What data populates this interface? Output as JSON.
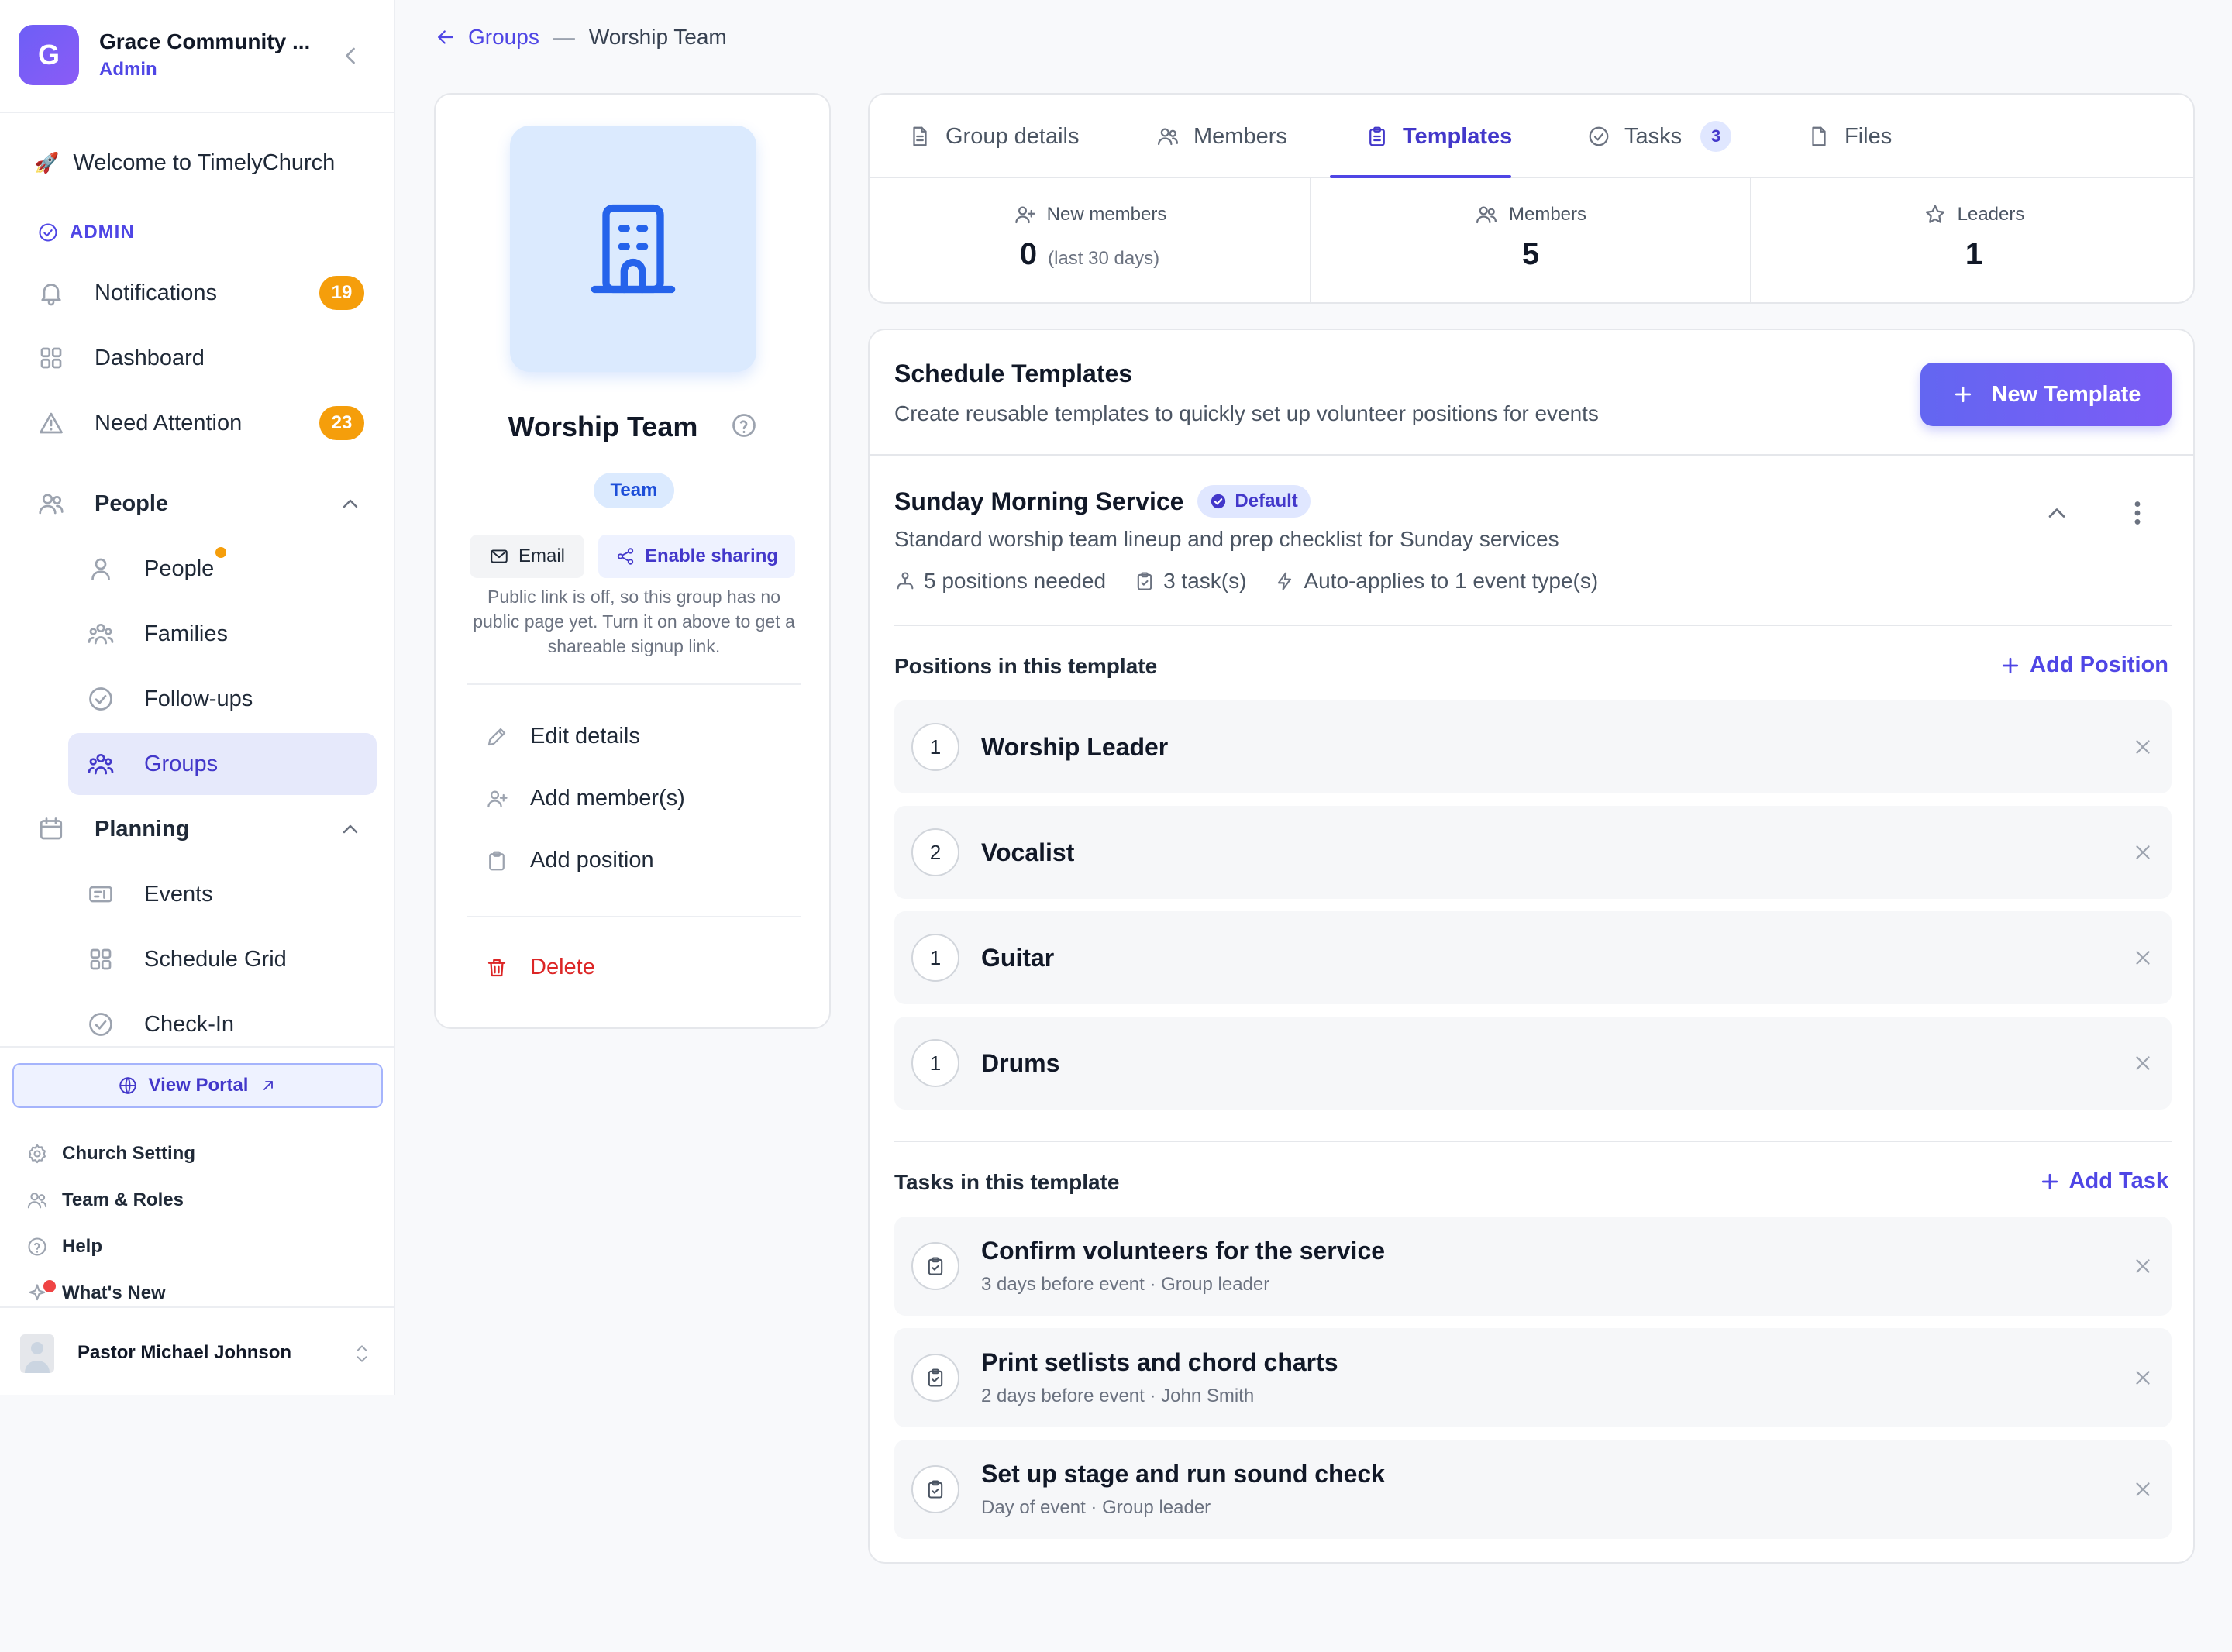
{
  "sidebar": {
    "org_initial": "G",
    "org_name": "Grace Community ...",
    "org_role": "Admin",
    "welcome": "Welcome to TimelyChurch",
    "admin_label": "ADMIN",
    "notifications": {
      "label": "Notifications",
      "count": "19"
    },
    "dashboard": {
      "label": "Dashboard"
    },
    "need_attention": {
      "label": "Need Attention",
      "count": "23"
    },
    "people_section": "People",
    "people_items": [
      "People",
      "Families",
      "Follow-ups",
      "Groups"
    ],
    "planning_section": "Planning",
    "planning_items": [
      "Events",
      "Schedule Grid",
      "Check-In"
    ],
    "view_portal": "View Portal",
    "utility": [
      "Church Setting",
      "Team & Roles",
      "Help",
      "What's New"
    ],
    "user_name": "Pastor Michael Johnson",
    "user_avatar_alt": "Pa"
  },
  "breadcrumb": {
    "back": "Groups",
    "separator": "—",
    "current": "Worship Team"
  },
  "profile": {
    "name": "Worship Team",
    "type": "Team",
    "email_label": "Email",
    "share_label": "Enable sharing",
    "sharing_note": "Public link is off, so this group has no public page yet. Turn it on above to get a shareable signup link.",
    "actions": {
      "edit": "Edit details",
      "add_member": "Add member(s)",
      "add_position": "Add position",
      "delete": "Delete"
    }
  },
  "tabs": [
    {
      "label": "Group details",
      "icon": "document-icon"
    },
    {
      "label": "Members",
      "icon": "users-icon"
    },
    {
      "label": "Templates",
      "icon": "clipboard-icon",
      "active": true
    },
    {
      "label": "Tasks",
      "icon": "check-circle-icon",
      "count": "3"
    },
    {
      "label": "Files",
      "icon": "file-icon"
    }
  ],
  "stats": {
    "new_members": {
      "label": "New members",
      "value": "0",
      "sub": "(last 30 days)"
    },
    "members": {
      "label": "Members",
      "value": "5"
    },
    "leaders": {
      "label": "Leaders",
      "value": "1"
    }
  },
  "templates": {
    "title": "Schedule Templates",
    "description": "Create reusable templates to quickly set up volunteer positions for events",
    "new_button": "New Template",
    "service": {
      "name": "Sunday Morning Service",
      "badge": "Default",
      "description": "Standard worship team lineup and prep checklist for Sunday services",
      "meta_positions": "5 positions needed",
      "meta_tasks": "3 task(s)",
      "meta_auto": "Auto-applies to 1 event type(s)"
    },
    "positions_title": "Positions in this template",
    "add_position": "Add Position",
    "positions": [
      {
        "count": "1",
        "name": "Worship Leader"
      },
      {
        "count": "2",
        "name": "Vocalist"
      },
      {
        "count": "1",
        "name": "Guitar"
      },
      {
        "count": "1",
        "name": "Drums"
      }
    ],
    "tasks_title": "Tasks in this template",
    "add_task": "Add Task",
    "tasks": [
      {
        "name": "Confirm volunteers for the service",
        "detail": "3 days before event · Group leader"
      },
      {
        "name": "Print setlists and chord charts",
        "detail": "2 days before event · John Smith"
      },
      {
        "name": "Set up stage and run sound check",
        "detail": "Day of event · Group leader"
      }
    ]
  },
  "colors": {
    "accent": "#4f46e5",
    "badge_orange": "#f59e0b",
    "danger": "#dc2626",
    "avatar_bg": "#dbeafe"
  }
}
